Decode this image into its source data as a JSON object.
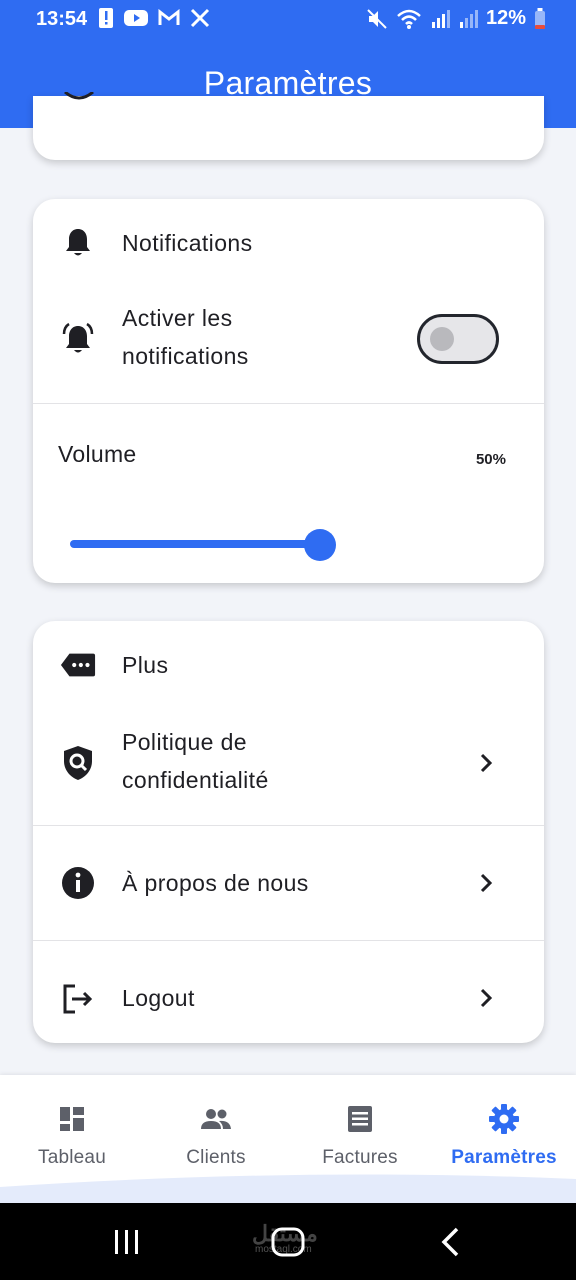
{
  "status_bar": {
    "time": "13:54",
    "battery": "12%"
  },
  "app_bar": {
    "title": "Paramètres"
  },
  "notifications_card": {
    "header": "Notifications",
    "enable_label": "Activer les notifications",
    "enable_line1": "Activer les",
    "enable_line2": "notifications",
    "enabled": false,
    "volume_label": "Volume",
    "volume_value": "50%",
    "volume_fraction": 0.5
  },
  "more_card": {
    "header": "Plus",
    "items": [
      {
        "line1": "Politique de",
        "line2": "confidentialité",
        "icon": "shield-search-icon"
      },
      {
        "label": "À propos de nous",
        "icon": "info-icon"
      },
      {
        "label": "Logout",
        "icon": "logout-icon"
      }
    ]
  },
  "bottom_nav": {
    "items": [
      {
        "label": "Tableau",
        "icon": "dashboard-icon",
        "active": false
      },
      {
        "label": "Clients",
        "icon": "people-icon",
        "active": false
      },
      {
        "label": "Factures",
        "icon": "receipt-icon",
        "active": false
      },
      {
        "label": "Paramètres",
        "icon": "gear-icon",
        "active": true
      }
    ]
  },
  "watermark": {
    "text": "مستقل",
    "sub": "mostaql.com"
  },
  "colors": {
    "primary": "#2f6cf2",
    "background": "#f2f4f9",
    "text": "#1f1f24"
  }
}
